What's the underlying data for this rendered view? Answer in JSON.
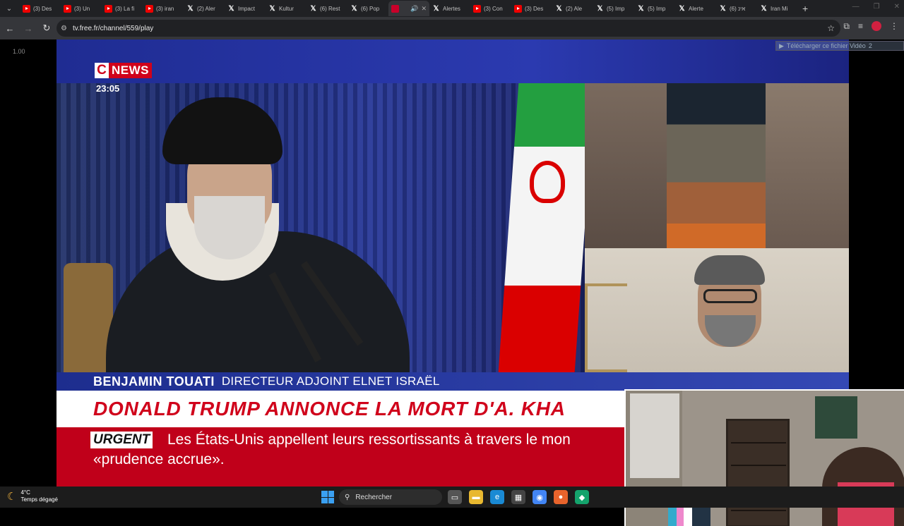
{
  "browser": {
    "tabs": [
      {
        "favicon": "youtube-icon",
        "title": "(3) Des"
      },
      {
        "favicon": "youtube-icon",
        "title": "(3) Un"
      },
      {
        "favicon": "youtube-icon",
        "title": "(3) La fi"
      },
      {
        "favicon": "youtube-icon",
        "title": "(3) iran"
      },
      {
        "favicon": "x-icon",
        "title": "(2) Aler"
      },
      {
        "favicon": "x-icon",
        "title": "Impact"
      },
      {
        "favicon": "x-icon",
        "title": "Kultur"
      },
      {
        "favicon": "x-icon",
        "title": "(6) Rest"
      },
      {
        "favicon": "x-icon",
        "title": "(6) Pop"
      },
      {
        "favicon": "free-icon",
        "title": "",
        "active": true
      },
      {
        "favicon": "x-icon",
        "title": "Alertes"
      },
      {
        "favicon": "youtube-icon",
        "title": "(3) Con"
      },
      {
        "favicon": "youtube-icon",
        "title": "(3) Des"
      },
      {
        "favicon": "x-icon",
        "title": "(2) Ale"
      },
      {
        "favicon": "x-icon",
        "title": "(5) Imp"
      },
      {
        "favicon": "x-icon",
        "title": "(5) Imp"
      },
      {
        "favicon": "x-icon",
        "title": "Alerte"
      },
      {
        "favicon": "x-icon",
        "title": "אינ (6)"
      },
      {
        "favicon": "x-icon",
        "title": "Iran Mi"
      }
    ],
    "new_tab": "+",
    "url": "tv.free.fr/channel/559/play"
  },
  "page": {
    "playback_speed": "1.00",
    "download_prompt": "Télécharger ce fichier Vidéo",
    "download_extra": "2"
  },
  "broadcast": {
    "channel_c": "C",
    "channel_news": "NEWS",
    "time": "23:05",
    "guest_name": "BENJAMIN TOUATI",
    "guest_role": "DIRECTEUR ADJOINT ELNET ISRAËL",
    "headline": "DONALD TRUMP ANNONCE LA MORT D'A. KHA",
    "urgent_label": "URGENT",
    "ticker_line1": "Les États-Unis appellent leurs ressortissants à travers le mon",
    "ticker_line2": "«prudence accrue»."
  },
  "taskbar": {
    "weather_temp": "4°C",
    "weather_desc": "Temps dégagé",
    "search_label": "Rechercher",
    "apps": [
      "task-view-icon",
      "file-explorer-icon",
      "edge-icon",
      "store-icon",
      "chrome-icon",
      "firefox-icon",
      "app-icon"
    ]
  },
  "colors": {
    "cnews_red": "#d0021b",
    "cnews_blue": "#1f2c92",
    "ticker_red": "#c0001a"
  }
}
